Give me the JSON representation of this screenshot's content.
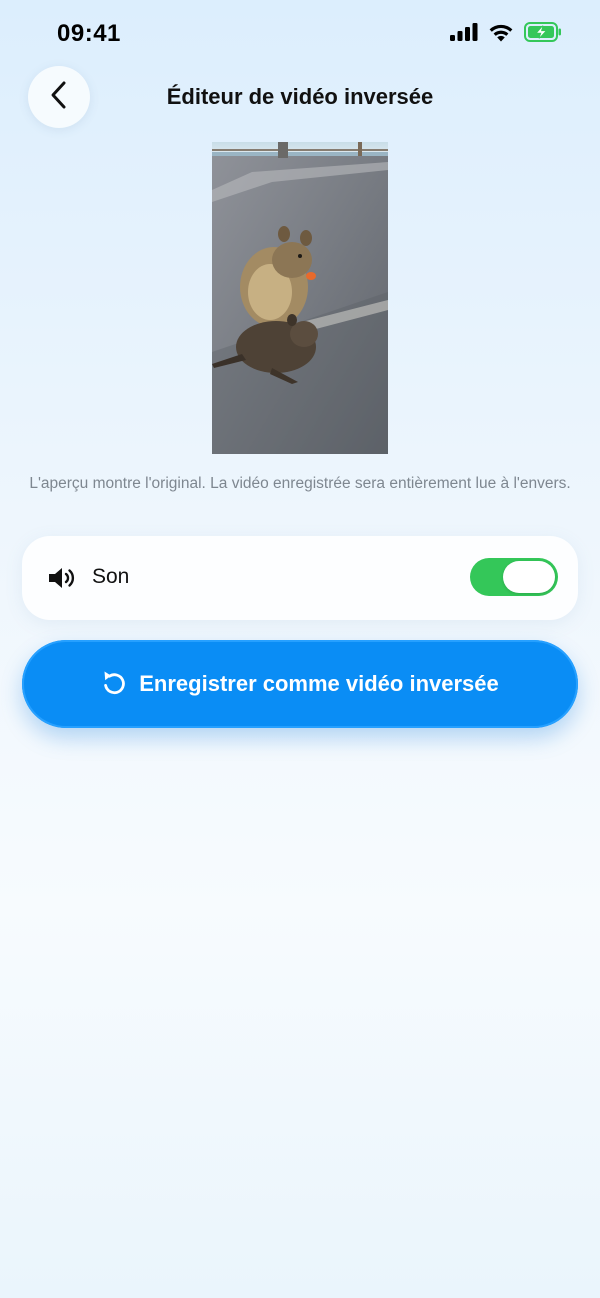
{
  "status_bar": {
    "time": "09:41",
    "icons": [
      "cellular-signal-icon",
      "wifi-icon",
      "battery-charging-icon"
    ],
    "battery_color": "#34c759"
  },
  "header": {
    "back_icon": "chevron-left-icon",
    "title": "Éditeur de vidéo inversée"
  },
  "preview": {
    "subject": "video-preview-quokkas",
    "note": "L'aperçu montre l'original. La vidéo enregistrée sera entièrement lue à l'envers."
  },
  "sound": {
    "icon": "speaker-icon",
    "label": "Son",
    "enabled": true,
    "toggle_color": "#34c759"
  },
  "save_button": {
    "icon": "reverse-arrow-icon",
    "label": "Enregistrer comme vidéo inversée",
    "color": "#0a8df5"
  }
}
